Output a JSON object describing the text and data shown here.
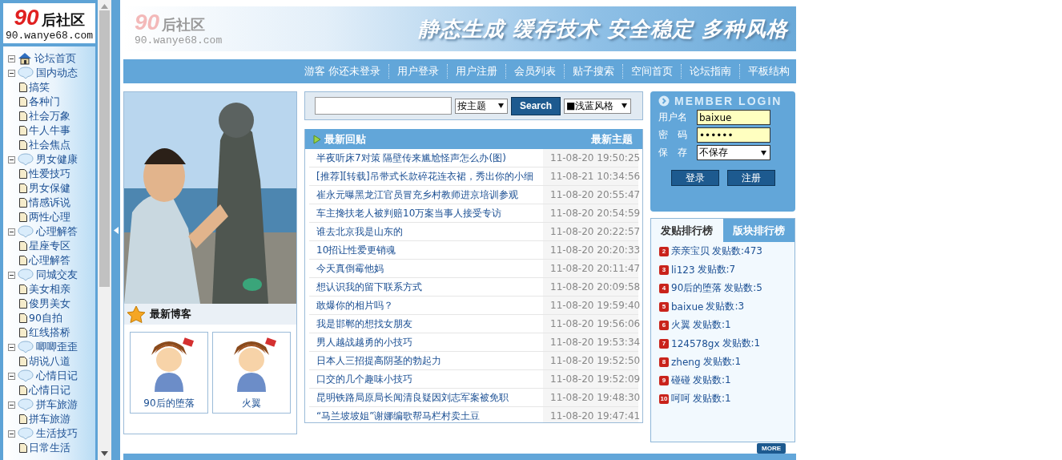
{
  "sidebar": {
    "logo": {
      "number": "90",
      "name": "后社区",
      "url": "90.wanye68.com"
    },
    "tree": [
      {
        "label": "论坛首页",
        "kind": "home",
        "expanded": true
      },
      {
        "label": "国内动态",
        "kind": "group",
        "expanded": true,
        "children": [
          {
            "label": "搞笑"
          },
          {
            "label": "各种门"
          },
          {
            "label": "社会万象"
          },
          {
            "label": "牛人牛事"
          },
          {
            "label": "社会焦点"
          }
        ]
      },
      {
        "label": "男女健康",
        "kind": "group",
        "expanded": true,
        "children": [
          {
            "label": "性爱技巧"
          },
          {
            "label": "男女保健"
          },
          {
            "label": "情感诉说"
          },
          {
            "label": "两性心理"
          }
        ]
      },
      {
        "label": "心理解答",
        "kind": "group",
        "expanded": true,
        "children": [
          {
            "label": "星座专区"
          },
          {
            "label": "心理解答"
          }
        ]
      },
      {
        "label": "同城交友",
        "kind": "group",
        "expanded": true,
        "children": [
          {
            "label": "美女相亲"
          },
          {
            "label": "俊男美女"
          },
          {
            "label": "90自拍"
          },
          {
            "label": "红线搭桥"
          }
        ]
      },
      {
        "label": "唧唧歪歪",
        "kind": "group",
        "expanded": true,
        "children": [
          {
            "label": "胡说八道"
          }
        ]
      },
      {
        "label": "心情日记",
        "kind": "group",
        "expanded": true,
        "children": [
          {
            "label": "心情日记"
          }
        ]
      },
      {
        "label": "拼车旅游",
        "kind": "group",
        "expanded": true,
        "children": [
          {
            "label": "拼车旅游"
          }
        ]
      },
      {
        "label": "生活技巧",
        "kind": "group",
        "expanded": true,
        "children": [
          {
            "label": "日常生活"
          }
        ]
      }
    ]
  },
  "header": {
    "logo": {
      "number": "90",
      "name": "后社区",
      "url": "90.wanye68.com"
    },
    "slogan": "静态生成 缓存技术 安全稳定 多种风格"
  },
  "nav": [
    "游客 你还未登录",
    "用户登录",
    "用户注册",
    "会员列表",
    "贴子搜索",
    "空间首页",
    "论坛指南",
    "平板结构"
  ],
  "blog": {
    "title": "最新博客",
    "items": [
      {
        "name": "90后的堕落"
      },
      {
        "name": "火翼"
      }
    ]
  },
  "search": {
    "scope": "按主题",
    "button": "Search",
    "style": "■浅蓝风格"
  },
  "posts": {
    "title": "最新回贴",
    "link": "最新主题",
    "rows": [
      {
        "title": "半夜听床7对策 隔壁传来尴尬怪声怎么办(图)",
        "time": "11-08-20 19:50:25"
      },
      {
        "title": "[推荐][转载]吊带式长款碎花连衣裙，秀出你的小细",
        "time": "11-08-21 10:34:56"
      },
      {
        "title": "崔永元曝黑龙江官员冒充乡村教师进京培训参观",
        "time": "11-08-20 20:55:47"
      },
      {
        "title": "车主搀扶老人被判赔10万案当事人接受专访",
        "time": "11-08-20 20:54:59"
      },
      {
        "title": "谁去北京我是山东的",
        "time": "11-08-20 20:22:57"
      },
      {
        "title": "10招让性爱更销魂",
        "time": "11-08-20 20:20:33"
      },
      {
        "title": "今天真倒霉他妈",
        "time": "11-08-20 20:11:47"
      },
      {
        "title": "想认识我的留下联系方式",
        "time": "11-08-20 20:09:58"
      },
      {
        "title": "敢爆你的相片吗？",
        "time": "11-08-20 19:59:40"
      },
      {
        "title": "我是邯郸的想找女朋友",
        "time": "11-08-20 19:56:06"
      },
      {
        "title": "男人越战越勇的小技巧",
        "time": "11-08-20 19:53:34"
      },
      {
        "title": "日本人三招提高阴茎的勃起力",
        "time": "11-08-20 19:52:50"
      },
      {
        "title": "口交的几个趣味小技巧",
        "time": "11-08-20 19:52:09"
      },
      {
        "title": "昆明铁路局原局长闻清良疑因刘志军案被免职",
        "time": "11-08-20 19:48:30"
      },
      {
        "title": "“马兰坡坡姐”谢娜编歌帮马栏村卖土豆",
        "time": "11-08-20 19:47:41"
      }
    ]
  },
  "login": {
    "title": "MEMBER LOGIN",
    "fields": [
      {
        "label": "用户名",
        "kind": "text",
        "value": "baixue"
      },
      {
        "label": "密　码",
        "kind": "password",
        "value": "••••••"
      },
      {
        "label": "保　存",
        "kind": "select",
        "value": "不保存"
      }
    ],
    "buttons": [
      "登录",
      "注册"
    ]
  },
  "ranking": {
    "tabs": [
      {
        "label": "发贴排行榜",
        "selected": true
      },
      {
        "label": "版块排行榜",
        "selected": false
      }
    ],
    "rows": [
      {
        "rank": "2",
        "name": "亲亲宝贝",
        "count": "发贴数:473"
      },
      {
        "rank": "3",
        "name": "li123",
        "count": "发贴数:7"
      },
      {
        "rank": "4",
        "name": "90后的堕落",
        "count": "发贴数:5"
      },
      {
        "rank": "5",
        "name": "baixue",
        "count": "发贴数:3"
      },
      {
        "rank": "6",
        "name": "火翼",
        "count": "发贴数:1"
      },
      {
        "rank": "7",
        "name": "124578gx",
        "count": "发贴数:1"
      },
      {
        "rank": "8",
        "name": "zheng",
        "count": "发贴数:1"
      },
      {
        "rank": "9",
        "name": "碰碰",
        "count": "发贴数:1"
      },
      {
        "rank": "10",
        "name": "呵呵",
        "count": "发贴数:1"
      }
    ],
    "more": "MORE"
  }
}
